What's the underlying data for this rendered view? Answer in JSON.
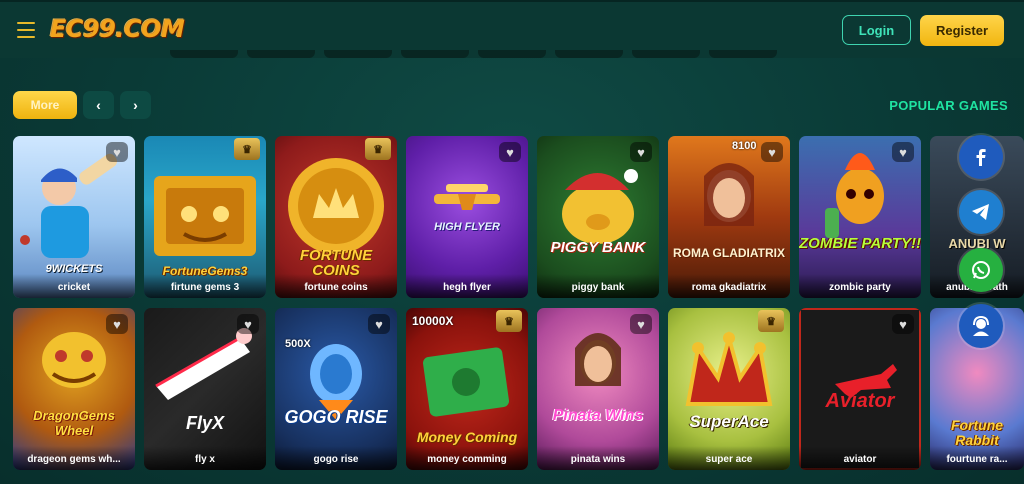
{
  "header": {
    "logo": "EC99.COM",
    "login_label": "Login",
    "register_label": "Register"
  },
  "toolbar": {
    "more_label": "More",
    "prev_label": "‹",
    "next_label": "›",
    "section_title": "POPULAR GAMES"
  },
  "games_row1": [
    {
      "name": "cricket",
      "art": "9WICKETS"
    },
    {
      "name": "firtune gems 3",
      "art": "FortuneGems3"
    },
    {
      "name": "fortune coins",
      "art": "FORTUNE COINS"
    },
    {
      "name": "hegh flyer",
      "art": "HIGH FLYER"
    },
    {
      "name": "piggy bank",
      "art": "PIGGY BANK"
    },
    {
      "name": "roma gkadiatrix",
      "art": "ROMA GLADIATRIX",
      "badge": "8100"
    },
    {
      "name": "zombic party",
      "art": "ZOMBIE PARTY!!"
    },
    {
      "name": "anubis wrath",
      "art": "ANUBI W"
    }
  ],
  "games_row2": [
    {
      "name": "drageon gems wh...",
      "art": "DragonGems Wheel"
    },
    {
      "name": "fly x",
      "art": "FlyX"
    },
    {
      "name": "gogo rise",
      "art": "GOGO RISE",
      "badge": "500X"
    },
    {
      "name": "money comming",
      "art": "Money Coming",
      "badge": "10000X"
    },
    {
      "name": "pinata wins",
      "art": "Pinata Wins"
    },
    {
      "name": "super ace",
      "art": "SuperAce"
    },
    {
      "name": "aviator",
      "art": "Aviator"
    },
    {
      "name": "fourtune ra...",
      "art": "Fortune Rabbit"
    }
  ],
  "social": [
    "facebook-icon",
    "telegram-icon",
    "whatsapp-icon",
    "support-icon"
  ],
  "colors": {
    "accent_yellow": "#f1b510",
    "accent_green": "#1fe3a1",
    "background": "#0a3a36"
  }
}
